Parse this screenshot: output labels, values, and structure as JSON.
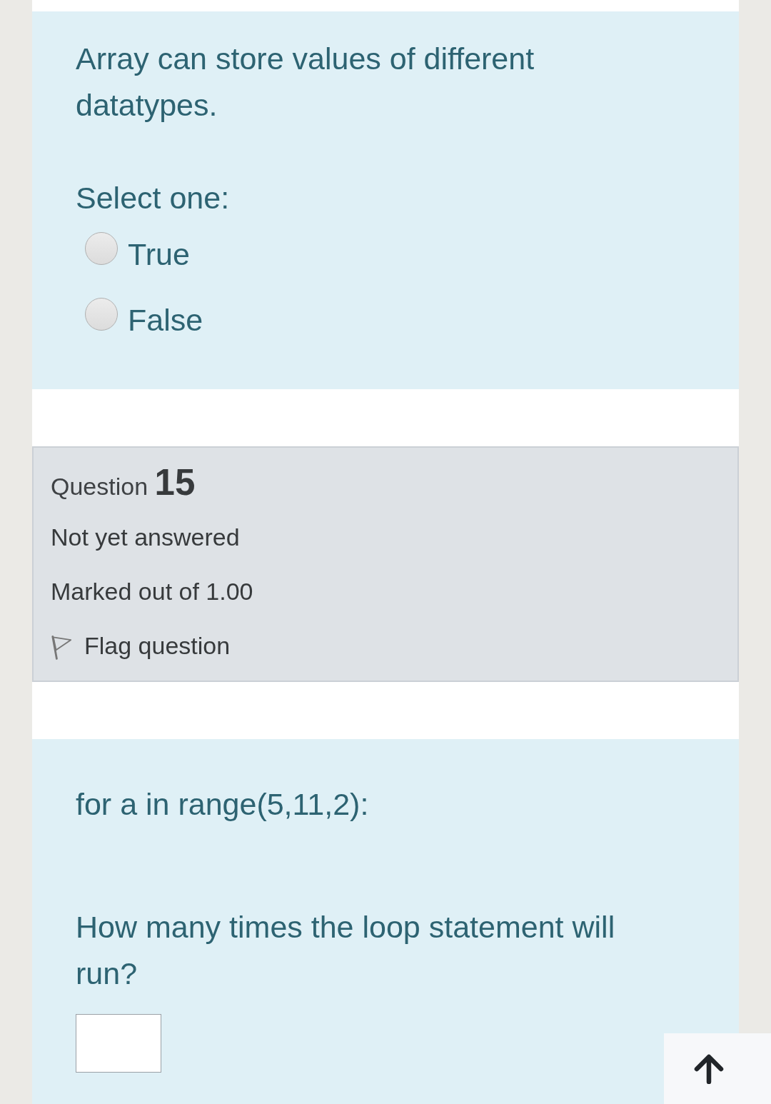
{
  "question_14": {
    "text": "Array can store values of different datatypes.",
    "prompt": "Select one:",
    "options": [
      {
        "label": "True",
        "selected": false
      },
      {
        "label": "False",
        "selected": false
      }
    ]
  },
  "question_15": {
    "info": {
      "label": "Question",
      "number": "15",
      "state": "Not yet answered",
      "grade": "Marked out of 1.00",
      "flag": {
        "label": "Flag question",
        "flagged": false
      }
    },
    "text": [
      "for a in range(5,11,2):",
      "How many times the loop statement will run?"
    ]
  }
}
